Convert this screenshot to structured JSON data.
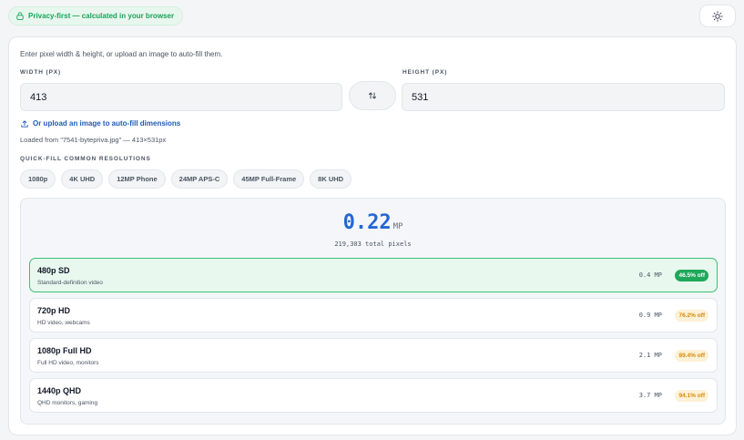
{
  "header": {
    "privacy_label": "Privacy-first — calculated in your browser",
    "theme_icon": "sun-icon"
  },
  "form": {
    "intro": "Enter pixel width & height, or upload an image to auto-fill them.",
    "width_label": "WIDTH (PX)",
    "width_value": "413",
    "height_label": "HEIGHT (PX)",
    "height_value": "531",
    "upload_label": "Or upload an image to auto-fill dimensions",
    "loaded_text": "Loaded from \"7541-bytepriva.jpg\" — 413×531px",
    "quick_fill_label": "QUICK-FILL COMMON RESOLUTIONS",
    "presets": [
      "1080p",
      "4K UHD",
      "12MP Phone",
      "24MP APS-C",
      "45MP Full-Frame",
      "8K UHD"
    ]
  },
  "result": {
    "mp_value": "0.22",
    "mp_unit": "MP",
    "total_pixels": "219,303 total pixels",
    "rows": [
      {
        "name": "480p SD",
        "desc": "Standard-definition video",
        "mp": "0.4 MP",
        "badge": "46.5% off",
        "active": true
      },
      {
        "name": "720p HD",
        "desc": "HD video, webcams",
        "mp": "0.9 MP",
        "badge": "76.2% off",
        "active": false
      },
      {
        "name": "1080p Full HD",
        "desc": "Full HD video, monitors",
        "mp": "2.1 MP",
        "badge": "89.4% off",
        "active": false
      },
      {
        "name": "1440p QHD",
        "desc": "QHD monitors, gaming",
        "mp": "3.7 MP",
        "badge": "94.1% off",
        "active": false
      }
    ]
  },
  "colors": {
    "accent": "#2467d4",
    "success": "#1fa85a",
    "warning": "#d98a0b"
  }
}
